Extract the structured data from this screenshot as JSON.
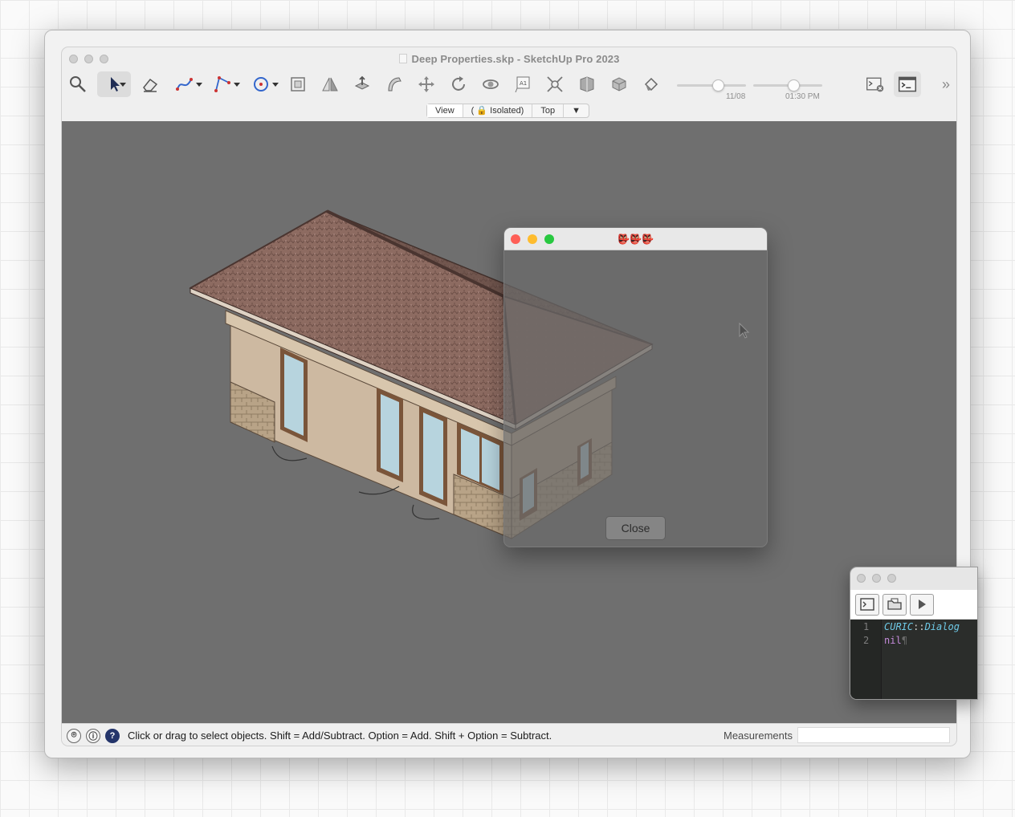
{
  "window": {
    "title": "Deep Properties.skp - SketchUp Pro 2023"
  },
  "toolbar": {
    "tools": [
      {
        "name": "search-icon"
      },
      {
        "name": "select-icon"
      },
      {
        "name": "eraser-icon"
      },
      {
        "name": "freehand-icon"
      },
      {
        "name": "line-icon"
      },
      {
        "name": "circle-icon"
      },
      {
        "name": "scale-icon"
      },
      {
        "name": "flip-icon"
      },
      {
        "name": "push-pull-icon"
      },
      {
        "name": "follow-me-icon"
      },
      {
        "name": "move-icon"
      },
      {
        "name": "rotate-icon"
      },
      {
        "name": "orbit-icon"
      },
      {
        "name": "text-icon"
      },
      {
        "name": "zoom-extents-icon"
      },
      {
        "name": "section-icon"
      },
      {
        "name": "component-icon"
      },
      {
        "name": "paint-icon"
      }
    ],
    "shadow_date": "11/08",
    "shadow_date_level": 0.62,
    "shadow_time": "01:30 PM",
    "shadow_time_level": 0.6,
    "ruby_console_icon": "ruby-console-icon",
    "terminal_icon": "terminal-icon"
  },
  "scene_bar": {
    "view": "View",
    "isolated": "Isolated)",
    "top": "Top",
    "dropdown": "▼"
  },
  "dialog": {
    "title": "👺👺👺",
    "close_button": "Close"
  },
  "console": {
    "line1_num": "1",
    "line1_module": "CURIC",
    "line1_sep": "::",
    "line1_class": "Dialog",
    "line2_num": "2",
    "line2_text": "nil",
    "line2_pilcrow": "¶"
  },
  "status": {
    "text": "Click or drag to select objects. Shift = Add/Subtract. Option = Add. Shift + Option = Subtract.",
    "measurements_label": "Measurements",
    "measurements_value": ""
  },
  "colors": {
    "viewport_bg": "#6f6f6f",
    "roof": "#8a6a5f",
    "wall": "#cbb8a0",
    "stone": "#b9a488",
    "window_glass": "#b7d4de",
    "window_frame": "#7a553a",
    "close_red": "#fe5f57",
    "min_yellow": "#febc2e",
    "max_green": "#28c840"
  }
}
